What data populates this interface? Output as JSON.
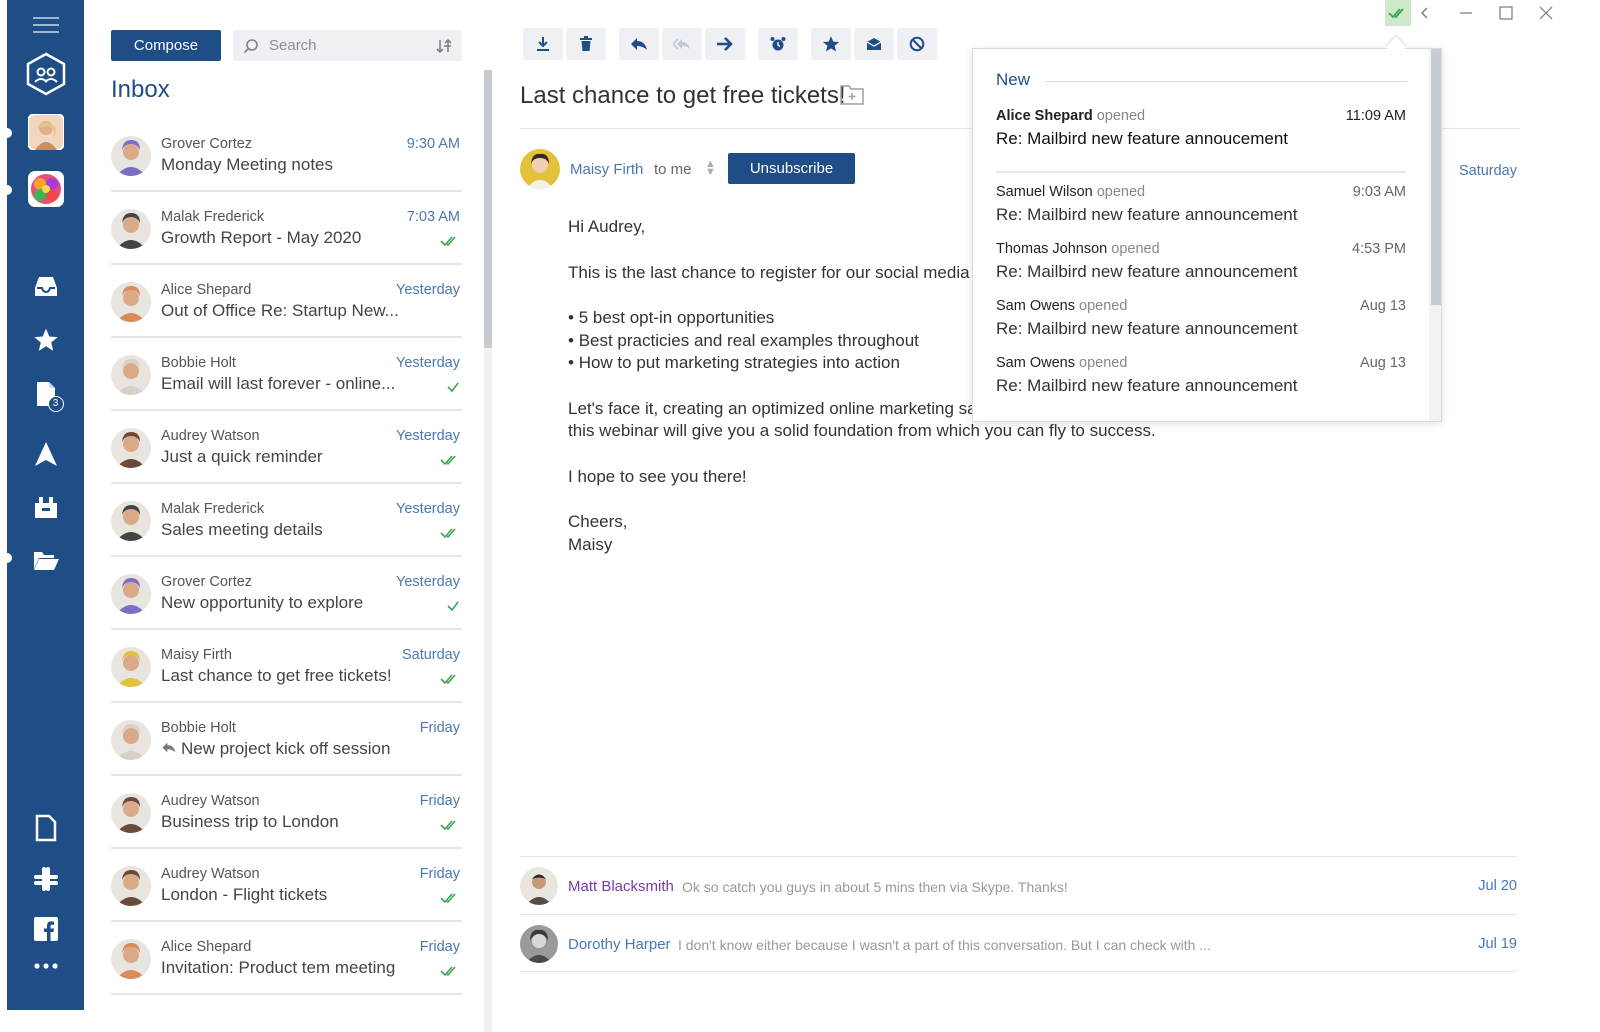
{
  "sidebar": {
    "accounts": [
      "unified-inbox",
      "account-user",
      "account-colorful"
    ],
    "nav": [
      "inbox",
      "starred",
      "drafts",
      "sent",
      "archive",
      "folders"
    ],
    "drafts_badge": "3",
    "apps": [
      "documents",
      "slack",
      "facebook",
      "more"
    ]
  },
  "list": {
    "compose_label": "Compose",
    "search_placeholder": "Search",
    "title": "Inbox",
    "items": [
      {
        "sender": "Grover Cortez",
        "subject": "Monday Meeting notes",
        "time": "9:30 AM",
        "check": "none",
        "avatar_color": "#7a6fc4"
      },
      {
        "sender": "Malak Frederick",
        "subject": "Growth Report - May 2020",
        "time": "7:03 AM",
        "check": "double",
        "avatar_color": "#444444"
      },
      {
        "sender": "Alice Shepard",
        "subject": "Out of Office Re: Startup New...",
        "time": "Yesterday",
        "check": "none",
        "avatar_color": "#d98b5a"
      },
      {
        "sender": "Bobbie Holt",
        "subject": "Email will last forever - online...",
        "time": "Yesterday",
        "check": "single",
        "avatar_color": "#d8cfc6"
      },
      {
        "sender": "Audrey Watson",
        "subject": "Just a quick reminder",
        "time": "Yesterday",
        "check": "double",
        "avatar_color": "#6b4a3a"
      },
      {
        "sender": "Malak Frederick",
        "subject": "Sales meeting details",
        "time": "Yesterday",
        "check": "double",
        "avatar_color": "#444444"
      },
      {
        "sender": "Grover Cortez",
        "subject": "New opportunity to explore",
        "time": "Yesterday",
        "check": "single",
        "avatar_color": "#7a6fc4"
      },
      {
        "sender": "Maisy Firth",
        "subject": "Last chance to get free tickets!",
        "time": "Saturday",
        "check": "double",
        "avatar_color": "#e3c13a"
      },
      {
        "sender": "Bobbie Holt",
        "subject": "New project kick off session",
        "time": "Friday",
        "check": "none",
        "avatar_color": "#d8cfc6",
        "replied": true
      },
      {
        "sender": "Audrey Watson",
        "subject": "Business trip to London",
        "time": "Friday",
        "check": "double",
        "avatar_color": "#6b4a3a"
      },
      {
        "sender": "Audrey Watson",
        "subject": "London - Flight tickets",
        "time": "Friday",
        "check": "double",
        "avatar_color": "#6b4a3a"
      },
      {
        "sender": "Alice Shepard",
        "subject": "Invitation: Product tem meeting",
        "time": "Friday",
        "check": "double",
        "avatar_color": "#d98b5a"
      }
    ]
  },
  "toolbar": {
    "buttons": [
      "download",
      "delete",
      "reply",
      "reply-all",
      "forward",
      "snooze",
      "star",
      "mark-read",
      "block"
    ]
  },
  "message": {
    "title": "Last chance to get free tickets!",
    "from_name": "Maisy Firth",
    "to": "to me",
    "unsubscribe_label": "Unsubscribe",
    "date": "Saturday",
    "greeting": "Hi Audrey,",
    "intro": "This is the last chance to register for our social media e",
    "bullets": [
      "5 best opt-in opportunities",
      "Best practicies and real examples throughout",
      "How to put marketing strategies into action"
    ],
    "para_line1": "Let's face it, creating an optimized online marketing sal",
    "para_line2": "this webinar will give you a solid foundation from which you can fly to success.",
    "closing": "I hope to see you there!",
    "signoff1": "Cheers,",
    "signoff2": "Maisy"
  },
  "thread": [
    {
      "name": "Matt Blacksmith",
      "snippet": "Ok so catch you guys in about 5 mins then via Skype. Thanks!",
      "date": "Jul 20"
    },
    {
      "name": "Dorothy Harper",
      "snippet": "I don't know either because I wasn't a part of this conversation. But I can check with ...",
      "date": "Jul 19"
    }
  ],
  "tracker": {
    "new_label": "New",
    "items": [
      {
        "name": "Alice Shepard",
        "action": "opened",
        "time": "11:09 AM",
        "subject": "Re: Mailbird new feature annoucement"
      },
      {
        "name": "Samuel Wilson",
        "action": "opened",
        "time": "9:03 AM",
        "subject": "Re: Mailbird new feature announcement"
      },
      {
        "name": "Thomas Johnson",
        "action": "opened",
        "time": "4:53 PM",
        "subject": "Re: Mailbird new feature announcement"
      },
      {
        "name": "Sam Owens",
        "action": "opened",
        "time": "Aug 13",
        "subject": "Re: Mailbird new feature announcement"
      },
      {
        "name": "Sam Owens",
        "action": "opened",
        "time": "Aug 13",
        "subject": "Re: Mailbird new feature announcement"
      }
    ]
  },
  "colors": {
    "brand": "#1f4e87",
    "link": "#4a78b3",
    "thread_name_1": "#7b3aa6",
    "thread_name_2": "#4a78b3",
    "check": "#3aa657"
  }
}
